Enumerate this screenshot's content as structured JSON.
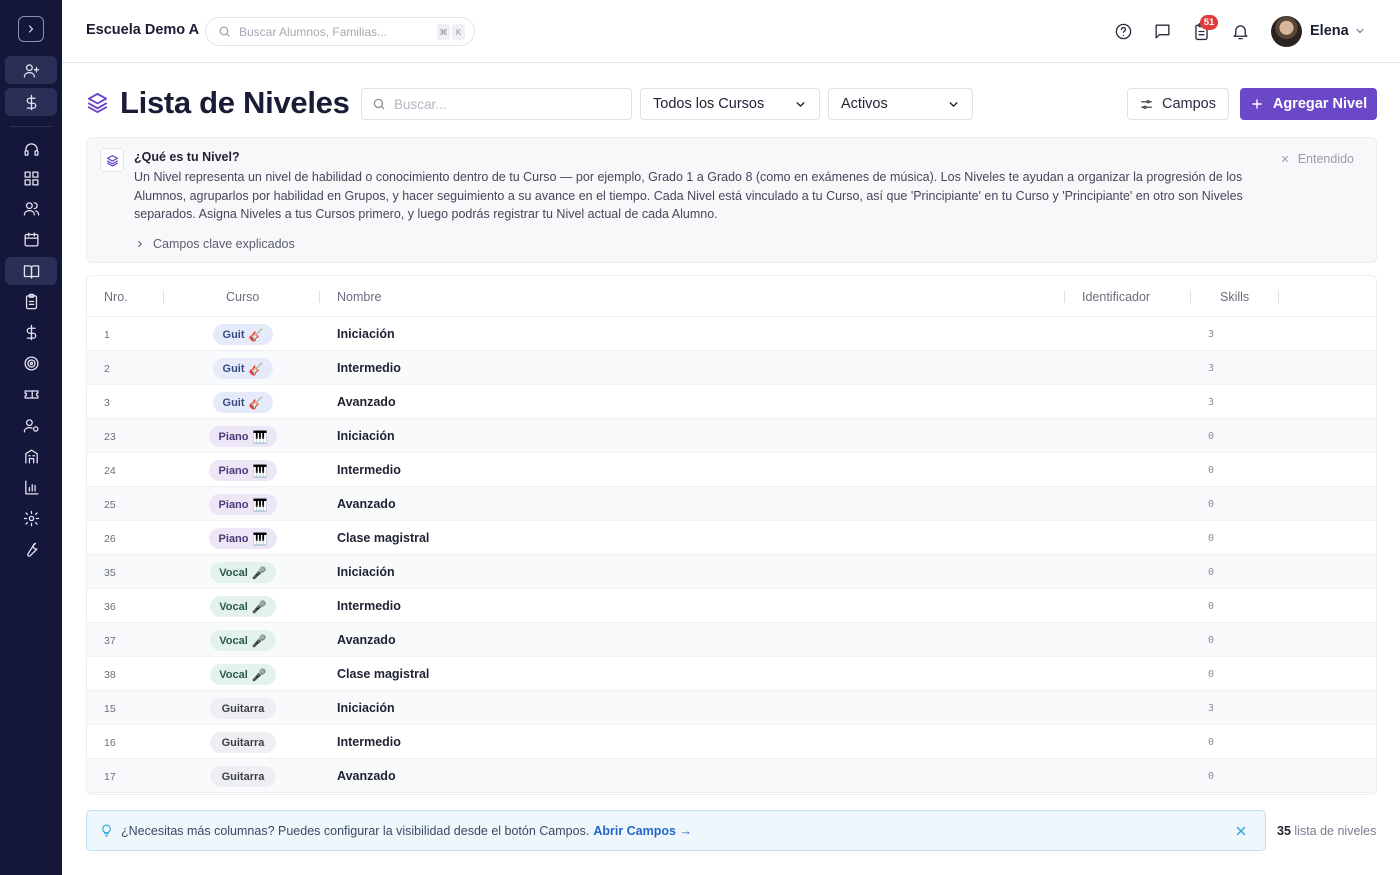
{
  "header": {
    "school_name": "Escuela Demo A",
    "search_placeholder": "Buscar Alumnos, Familias...",
    "shortcut_keys": [
      "⌘",
      "K"
    ],
    "notification_count": "51",
    "user_name": "Elena"
  },
  "page": {
    "title": "Lista de Niveles",
    "search_placeholder": "Buscar...",
    "course_filter": "Todos los Cursos",
    "status_filter": "Activos",
    "fields_button": "Campos",
    "add_button": "Agregar Nivel"
  },
  "info": {
    "title": "¿Qué es tu Nivel?",
    "body": "Un Nivel representa un nivel de habilidad o conocimiento dentro de tu Curso — por ejemplo, Grado 1 a Grado 8 (como en exámenes de música). Los Niveles te ayudan a organizar la progresión de los Alumnos, agruparlos por habilidad en Grupos, y hacer seguimiento a su avance en el tiempo. Cada Nivel está vinculado a tu Curso, así que 'Principiante' en tu Curso y 'Principiante' en otro son Niveles separados. Asigna Niveles a tus Cursos primero, y luego podrás registrar tu Nivel actual de cada Alumno.",
    "dismiss": "Entendido",
    "expand": "Campos clave explicados"
  },
  "table": {
    "columns": [
      "Nro.",
      "Curso",
      "Nombre",
      "Identificador",
      "Skills"
    ],
    "rows": [
      {
        "nro": "1",
        "course": "Guit",
        "emoji": "🎸",
        "name": "Iniciación",
        "skills": "3"
      },
      {
        "nro": "2",
        "course": "Guit",
        "emoji": "🎸",
        "name": "Intermedio",
        "skills": "3"
      },
      {
        "nro": "3",
        "course": "Guit",
        "emoji": "🎸",
        "name": "Avanzado",
        "skills": "3"
      },
      {
        "nro": "23",
        "course": "Piano",
        "emoji": "🎹",
        "name": "Iniciación",
        "skills": "0"
      },
      {
        "nro": "24",
        "course": "Piano",
        "emoji": "🎹",
        "name": "Intermedio",
        "skills": "0"
      },
      {
        "nro": "25",
        "course": "Piano",
        "emoji": "🎹",
        "name": "Avanzado",
        "skills": "0"
      },
      {
        "nro": "26",
        "course": "Piano",
        "emoji": "🎹",
        "name": "Clase magistral",
        "skills": "0"
      },
      {
        "nro": "35",
        "course": "Vocal",
        "emoji": "🎤",
        "name": "Iniciación",
        "skills": "0"
      },
      {
        "nro": "36",
        "course": "Vocal",
        "emoji": "🎤",
        "name": "Intermedio",
        "skills": "0"
      },
      {
        "nro": "37",
        "course": "Vocal",
        "emoji": "🎤",
        "name": "Avanzado",
        "skills": "0"
      },
      {
        "nro": "38",
        "course": "Vocal",
        "emoji": "🎤",
        "name": "Clase magistral",
        "skills": "0"
      },
      {
        "nro": "15",
        "course": "Guitarra",
        "emoji": "",
        "name": "Iniciación",
        "skills": "3"
      },
      {
        "nro": "16",
        "course": "Guitarra",
        "emoji": "",
        "name": "Intermedio",
        "skills": "0"
      },
      {
        "nro": "17",
        "course": "Guitarra",
        "emoji": "",
        "name": "Avanzado",
        "skills": "0"
      }
    ]
  },
  "badge_colors": {
    "Guit": {
      "bg": "#e6ebfb",
      "fg": "#3b4a86"
    },
    "Piano": {
      "bg": "#ece6f7",
      "fg": "#4a3a78"
    },
    "Vocal": {
      "bg": "#e3f3ec",
      "fg": "#2d5a48"
    },
    "Guitarra": {
      "bg": "#eeeff2",
      "fg": "#3c3f4a"
    }
  },
  "tip": {
    "text": "¿Necesitas más columnas? Puedes configurar la visibilidad desde el botón Campos.",
    "link": "Abrir Campos →"
  },
  "footer": {
    "count": "35",
    "count_label": "lista de niveles"
  },
  "colors": {
    "accent": "#6b48c8",
    "sidebar": "#15173a",
    "badge_red": "#e23b3b",
    "link": "#2466c8"
  }
}
